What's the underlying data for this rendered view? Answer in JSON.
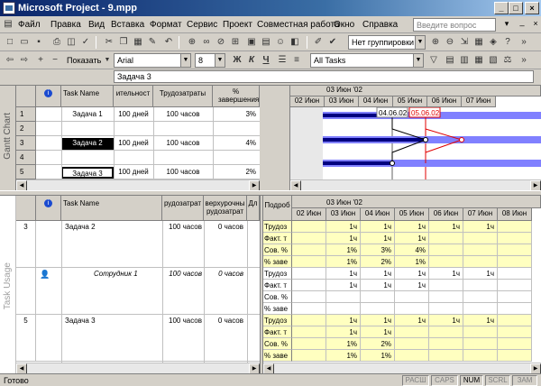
{
  "window": {
    "title": "Microsoft Project - 9.mpp"
  },
  "menu": [
    "Файл",
    "Правка",
    "Вид",
    "Вставка",
    "Формат",
    "Сервис",
    "Проект",
    "Совместная работа",
    "Окно",
    "Справка"
  ],
  "help_placeholder": "Введите вопрос",
  "toolbar1": {
    "grouping": "Нет группировки"
  },
  "toolbar2": {
    "show": "Показать",
    "font": "Arial",
    "size": "8",
    "bold": "Ж",
    "italic": "К",
    "underline": "Ч",
    "filter": "All Tasks"
  },
  "editbar": {
    "value": "Задача 3"
  },
  "top": {
    "view_label": "Gantt Chart",
    "cols": [
      "Task Name",
      "ительност",
      "Трудозатраты",
      "% завершения"
    ],
    "rows": [
      {
        "id": "1",
        "name": "Задача 1",
        "dur": "100 дней",
        "work": "100 часов",
        "pct": "3%"
      },
      {
        "id": "2",
        "name": "",
        "dur": "",
        "work": "",
        "pct": ""
      },
      {
        "id": "3",
        "name": "Задача 2",
        "dur": "100 дней",
        "work": "100 часов",
        "pct": "4%"
      },
      {
        "id": "4",
        "name": "",
        "dur": "",
        "work": "",
        "pct": ""
      },
      {
        "id": "5",
        "name": "Задача 3",
        "dur": "100 дней",
        "work": "100 часов",
        "pct": "2%"
      }
    ],
    "gantt_week": "03 Июн '02",
    "gantt_days": [
      "02 Июн",
      "03 Июн",
      "04 Июн",
      "05 Июн",
      "06 Июн",
      "07 Июн"
    ],
    "date_a": "04.06.02",
    "date_b": "05.06.02"
  },
  "bottom": {
    "view_label": "Task Usage",
    "cols": [
      "Task Name",
      "рудозатрат",
      "верхурочны рудозатрат",
      "Дл"
    ],
    "detail_hdr": "Подроб",
    "week": "03 Июн '02",
    "days": [
      "02 Июн",
      "03 Июн",
      "04 Июн",
      "05 Июн",
      "06 Июн",
      "07 Июн",
      "08 Июн"
    ],
    "groups": [
      {
        "id": "3",
        "name": "Задача 2",
        "work": "100 часов",
        "ot": "0 часов",
        "italic": false,
        "rows": [
          {
            "lbl": "Трудоз",
            "v": [
              "",
              "1ч",
              "1ч",
              "1ч",
              "1ч",
              "1ч",
              ""
            ]
          },
          {
            "lbl": "Факт. т",
            "v": [
              "",
              "1ч",
              "1ч",
              "1ч",
              "",
              "",
              ""
            ]
          },
          {
            "lbl": "Сов. %",
            "v": [
              "",
              "1%",
              "3%",
              "4%",
              "",
              "",
              ""
            ]
          },
          {
            "lbl": "% заве",
            "v": [
              "",
              "1%",
              "2%",
              "1%",
              "",
              "",
              ""
            ]
          }
        ]
      },
      {
        "id": "",
        "name": "Сотрудник 1",
        "work": "100 часов",
        "ot": "0 часов",
        "italic": true,
        "rows": [
          {
            "lbl": "Трудоз",
            "v": [
              "",
              "1ч",
              "1ч",
              "1ч",
              "1ч",
              "1ч",
              ""
            ]
          },
          {
            "lbl": "Факт. т",
            "v": [
              "",
              "1ч",
              "1ч",
              "1ч",
              "",
              "",
              ""
            ]
          },
          {
            "lbl": "Сов. %",
            "v": [
              "",
              "",
              "",
              "",
              "",
              "",
              ""
            ]
          },
          {
            "lbl": "% заве",
            "v": [
              "",
              "",
              "",
              "",
              "",
              "",
              ""
            ]
          }
        ]
      },
      {
        "id": "5",
        "name": "Задача 3",
        "work": "100 часов",
        "ot": "0 часов",
        "italic": false,
        "rows": [
          {
            "lbl": "Трудоз",
            "v": [
              "",
              "1ч",
              "1ч",
              "1ч",
              "1ч",
              "1ч",
              ""
            ]
          },
          {
            "lbl": "Факт. т",
            "v": [
              "",
              "1ч",
              "1ч",
              "",
              "",
              "",
              ""
            ]
          },
          {
            "lbl": "Сов. %",
            "v": [
              "",
              "1%",
              "2%",
              "",
              "",
              "",
              ""
            ]
          },
          {
            "lbl": "% заве",
            "v": [
              "",
              "1%",
              "1%",
              "",
              "",
              "",
              ""
            ]
          }
        ]
      }
    ]
  },
  "status": {
    "ready": "Готово",
    "indicators": [
      "РАСШ",
      "CAPS",
      "NUM",
      "SCRL",
      "ЗАМ"
    ]
  }
}
